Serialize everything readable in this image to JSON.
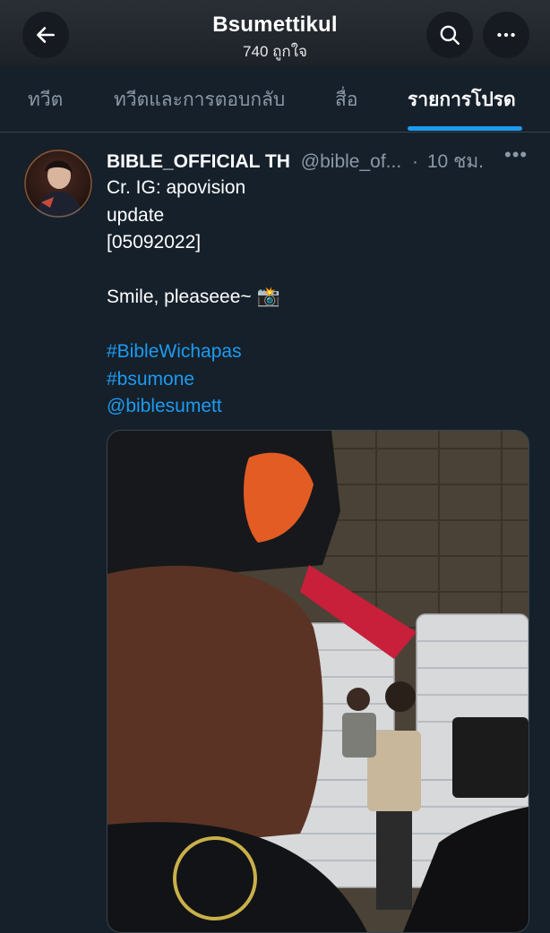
{
  "header": {
    "title": "Bsumettikul",
    "subtitle": "740 ถูกใจ",
    "icons": {
      "back": "arrow-left-icon",
      "search": "search-icon",
      "more": "more-horizontal-icon"
    }
  },
  "tabs": [
    {
      "label": "ทวีต",
      "active": false
    },
    {
      "label": "ทวีตและการตอบกลับ",
      "active": false
    },
    {
      "label": "สื่อ",
      "active": false
    },
    {
      "label": "รายการโปรด",
      "active": true
    }
  ],
  "tweet": {
    "author_name": "BIBLE_OFFICIAL TH",
    "handle": "@bible_of...",
    "separator": "·",
    "time": "10 ชม.",
    "more": "•••",
    "lines": [
      "Cr. IG: apovision",
      "update",
      "[05092022]"
    ],
    "body": "Smile, pleaseee~ 📸",
    "hashtags": [
      "#BibleWichapas",
      "#bsumone"
    ],
    "mention": "@biblesumett"
  },
  "colors": {
    "accent": "#1d9bf0",
    "background": "#15202b",
    "muted": "#8b98a5"
  }
}
